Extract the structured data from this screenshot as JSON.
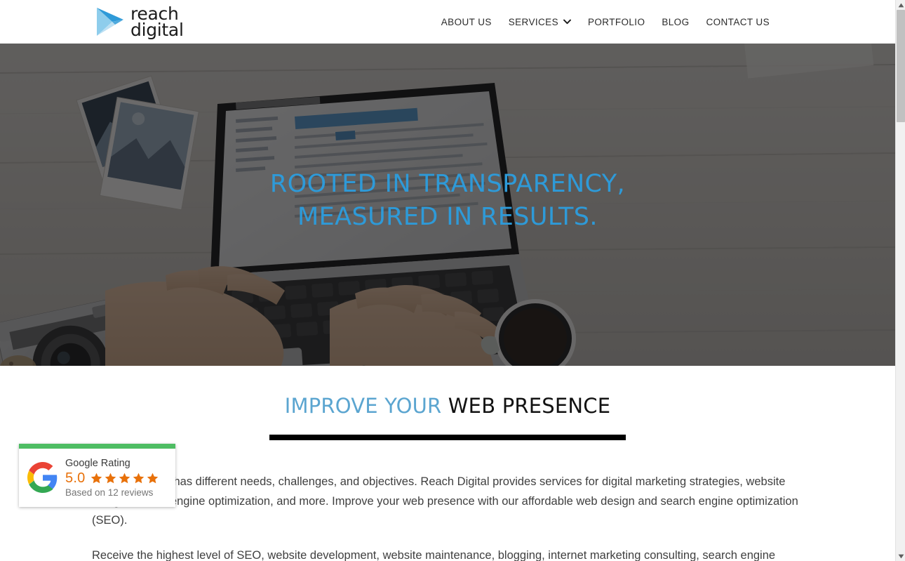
{
  "brand": {
    "name_line1": "reach",
    "name_line2": "digital",
    "logo_icon": "play-triangle-logo",
    "logo_color_light": "#8ecdec",
    "logo_color_dark": "#2e9ad8"
  },
  "nav": {
    "items": [
      {
        "label": "ABOUT US",
        "has_caret": false
      },
      {
        "label": "SERVICES",
        "has_caret": true,
        "caret_icon": "chevron-down-icon"
      },
      {
        "label": "PORTFOLIO",
        "has_caret": false
      },
      {
        "label": "BLOG",
        "has_caret": false
      },
      {
        "label": "CONTACT US",
        "has_caret": false
      }
    ]
  },
  "hero": {
    "line1": "ROOTED IN TRANSPARENCY,",
    "line2": "MEASURED IN RESULTS.",
    "heading_color": "#2e9ad8",
    "image_alt": "hands typing on laptop keyboard on white wood desk with camera, photos and coffee cup"
  },
  "section": {
    "heading_blue": "IMPROVE YOUR",
    "heading_dark": " WEB PRESENCE",
    "heading_blue_color": "#5ba5d0",
    "heading_dark_color": "#121212",
    "rule_color": "#000000",
    "paragraph_1": "Every business has different needs, challenges, and objectives. Reach Digital provides services for digital marketing strategies, website design, search engine optimization, and more. Improve your web presence with our affordable web design and search engine optimization (SEO).",
    "paragraph_2": "Receive the highest level of SEO, website development, website maintenance, blogging, internet marketing consulting, search engine"
  },
  "google_badge": {
    "bar_color": "#4ebd63",
    "logo_icon": "google-g-icon",
    "title": "Google Rating",
    "score": "5.0",
    "score_color": "#e8710a",
    "stars": 5,
    "star_icon": "star-icon",
    "star_color": "#e8710a",
    "reviews_text": "Based on 12 reviews"
  },
  "scrollbar": {
    "up_icon": "scroll-up-arrow-icon",
    "down_icon": "scroll-down-arrow-icon",
    "thumb_color": "#c1c1c1",
    "track_color": "#f1f1f1"
  }
}
